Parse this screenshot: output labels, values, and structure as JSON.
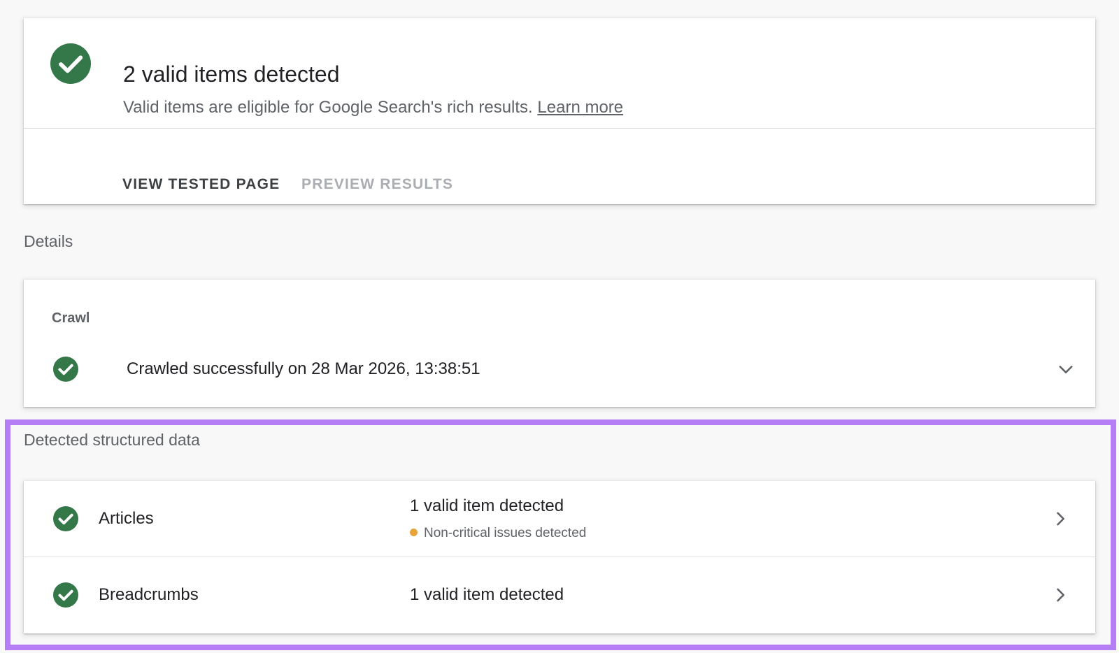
{
  "summary": {
    "headline": "2 valid items detected",
    "subtext": "Valid items are eligible for Google Search's rich results.",
    "learn_more": "Learn more",
    "actions": {
      "view_tested_page": "VIEW TESTED PAGE",
      "preview_results": "PREVIEW RESULTS"
    }
  },
  "details": {
    "label": "Details",
    "crawl": {
      "title": "Crawl",
      "status": "Crawled successfully on 28 Mar 2026, 13:38:51"
    }
  },
  "structured_data": {
    "label": "Detected structured data",
    "items": [
      {
        "name": "Articles",
        "valid": "1 valid item detected",
        "issue": "Non-critical issues detected"
      },
      {
        "name": "Breadcrumbs",
        "valid": "1 valid item detected"
      }
    ]
  },
  "colors": {
    "success_green": "#34784a",
    "warning_orange": "#e8a33b",
    "highlight_purple": "#b67ef5",
    "background": "#f8f8f8"
  },
  "icons": {
    "success": "check-circle-icon",
    "expand": "chevron-down-icon",
    "open": "chevron-right-icon"
  }
}
